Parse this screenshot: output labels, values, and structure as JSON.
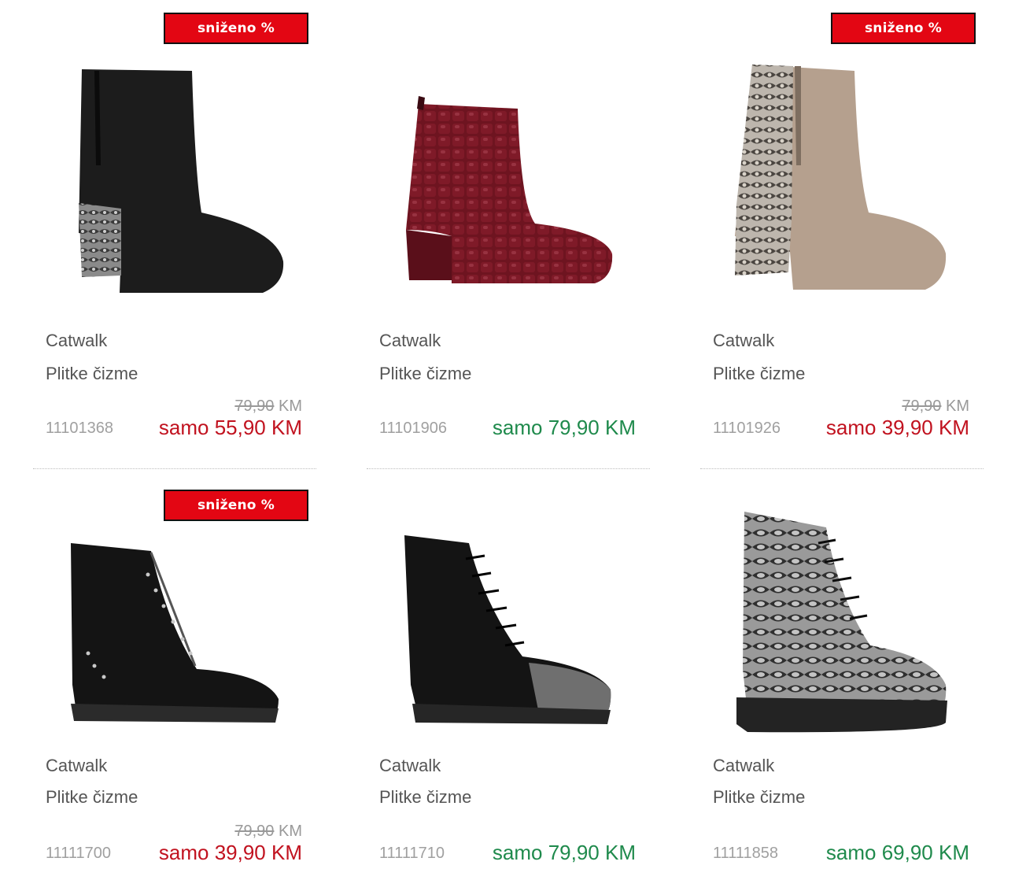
{
  "colors": {
    "badge": "#e30613",
    "sale_price": "#c1121f",
    "regular_price": "#1f8a4c",
    "muted_text": "#a0a0a0"
  },
  "currency": "KM",
  "products": [
    {
      "badge": "sniženo %",
      "brand": "Catwalk",
      "name": "Plitke čizme",
      "sku": "11101368",
      "old_price": "79,90",
      "price": "samo 55,90 KM",
      "image_icon": "black-suede-ankle-boot-snake-heel"
    },
    {
      "badge": "",
      "brand": "Catwalk",
      "name": "Plitke čizme",
      "sku": "11101906",
      "old_price": "",
      "price": "samo 79,90 KM",
      "image_icon": "burgundy-croc-ankle-boot"
    },
    {
      "badge": "sniženo %",
      "brand": "Catwalk",
      "name": "Plitke čizme",
      "sku": "11101926",
      "old_price": "79,90",
      "price": "samo 39,90 KM",
      "image_icon": "taupe-snake-ankle-boot"
    },
    {
      "badge": "sniženo %",
      "brand": "Catwalk",
      "name": "Plitke čizme",
      "sku": "11111700",
      "old_price": "79,90",
      "price": "samo 39,90 KM",
      "image_icon": "black-studded-lace-boot"
    },
    {
      "badge": "",
      "brand": "Catwalk",
      "name": "Plitke čizme",
      "sku": "11111710",
      "old_price": "",
      "price": "samo 79,90 KM",
      "image_icon": "black-glitter-toe-lace-boot"
    },
    {
      "badge": "",
      "brand": "Catwalk",
      "name": "Plitke čizme",
      "sku": "11111858",
      "old_price": "",
      "price": "samo 69,90 KM",
      "image_icon": "snake-print-lace-boot"
    }
  ]
}
